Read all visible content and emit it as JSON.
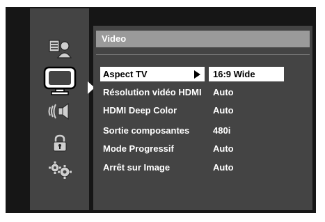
{
  "header": {
    "title": "Video"
  },
  "sidebar": {
    "icons": [
      "picture-sound-icon",
      "tv-screen-icon",
      "speaker-sound-icon",
      "lock-icon",
      "gears-icon"
    ],
    "selected": "tv-screen-icon"
  },
  "menu": {
    "items": [
      {
        "label": "Aspect TV",
        "value": "16:9 Wide"
      },
      {
        "label": "Résolution vidéo HDMI",
        "value": "Auto"
      },
      {
        "label": "HDMI Deep Color",
        "value": "Auto"
      },
      {
        "label": "Sortie composantes",
        "value": "480i"
      },
      {
        "label": "Mode Progressif",
        "value": "Auto"
      },
      {
        "label": "Arrêt sur Image",
        "value": "Auto"
      }
    ]
  },
  "colors": {
    "background": "#161616",
    "panel": "#444444",
    "header_bar": "#9a9a9a",
    "highlight": "#ffffff"
  }
}
